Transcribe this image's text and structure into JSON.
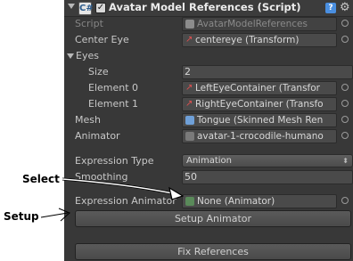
{
  "header": {
    "title": "Avatar Model References (Script)",
    "script_icon_glyph": "C#",
    "check_glyph": "✓",
    "help_glyph": "?",
    "gear_glyph": "⚙"
  },
  "fields": {
    "script": {
      "label": "Script",
      "value": "AvatarModelReferences"
    },
    "centre_eye": {
      "label": "Center Eye",
      "value": "centereye (Transform)"
    },
    "eyes": {
      "label": "Eyes"
    },
    "size": {
      "label": "Size",
      "value": "2"
    },
    "element0": {
      "label": "Element 0",
      "value": "LeftEyeContainer (Transfor"
    },
    "element1": {
      "label": "Element 1",
      "value": "RightEyeContainer (Transfo"
    },
    "mesh": {
      "label": "Mesh",
      "value": "Tongue (Skinned Mesh Ren"
    },
    "animator": {
      "label": "Animator",
      "value": "avatar-1-crocodile-humano"
    },
    "expression_type": {
      "label": "Expression Type",
      "value": "Animation",
      "arrow": "⬍"
    },
    "smoothing": {
      "label": "Smoothing",
      "value": "50"
    },
    "expression_animator": {
      "label": "Expression Animator",
      "value": "None (Animator)"
    }
  },
  "buttons": {
    "setup": "Setup Animator",
    "fix": "Fix References"
  },
  "annotations": {
    "select": "Select",
    "setup": "Setup"
  }
}
